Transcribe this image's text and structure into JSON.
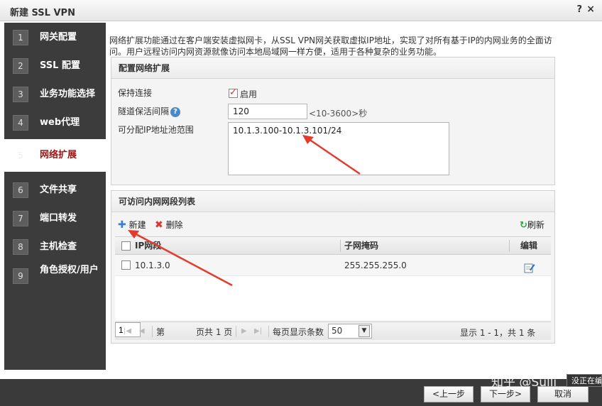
{
  "window": {
    "title": "新建 SSL VPN",
    "help": "?",
    "close": "×"
  },
  "steps": [
    {
      "num": "1",
      "label": "网关配置"
    },
    {
      "num": "2",
      "label": "SSL 配置"
    },
    {
      "num": "3",
      "label": "业务功能选择"
    },
    {
      "num": "4",
      "label": "web代理"
    },
    {
      "num": "5",
      "label": "网络扩展"
    },
    {
      "num": "6",
      "label": "文件共享"
    },
    {
      "num": "7",
      "label": "端口转发"
    },
    {
      "num": "8",
      "label": "主机检查"
    },
    {
      "num": "9",
      "label": "角色授权/用户"
    }
  ],
  "description": "网络扩展功能通过在客户端安装虚拟网卡，从SSL VPN网关获取虚拟IP地址，实现了对所有基于IP的内网业务的全面访问。用户远程访问内网资源就像访问本地局域网一样方便，适用于各种复杂的业务功能。",
  "config_panel": {
    "title": "配置网络扩展",
    "keep_alive_label": "保持连接",
    "enable_label": "启用",
    "enable_checked": true,
    "tunnel_interval_label": "隧道保活间隔",
    "tunnel_interval_value": "120",
    "tunnel_interval_hint": "<10-3600>秒",
    "ip_pool_label": "可分配IP地址池范围",
    "ip_pool_value": "10.1.3.100-10.1.3.101/24"
  },
  "list_panel": {
    "title": "可访问内网网段列表",
    "new_label": "新建",
    "delete_label": "删除",
    "refresh_label": "刷新",
    "columns": [
      "IP网段",
      "子网掩码",
      "编辑"
    ],
    "rows": [
      {
        "ip": "10.1.3.0",
        "mask": "255.255.255.0"
      }
    ]
  },
  "pager": {
    "page_prefix": "第",
    "page_value": "1",
    "page_suffix": "页共 1 页",
    "per_page_label": "每页显示条数",
    "per_page_value": "50",
    "summary": "显示 1 - 1，共 1 条"
  },
  "footer": {
    "prev": "<上一步",
    "next": "下一步>",
    "cancel": "取消"
  },
  "watermark": {
    "text": "知乎 @Sulli",
    "tooltip": "没正在编"
  }
}
